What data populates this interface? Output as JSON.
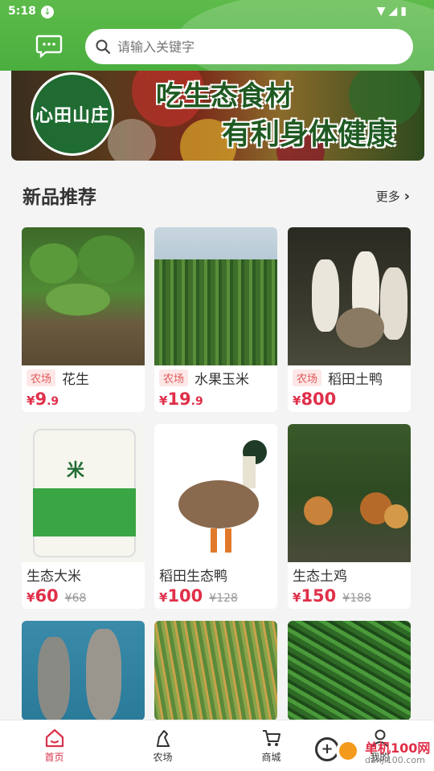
{
  "status_bar": {
    "time": "5:18",
    "icons": "▼◢▮"
  },
  "search": {
    "placeholder": "请输入关键字"
  },
  "banner": {
    "logo_text": "心田山庄",
    "line1": "吃生态食材",
    "line2": "有利身体健康"
  },
  "section": {
    "title": "新品推荐",
    "more": "更多"
  },
  "products": [
    {
      "tag": "农场",
      "name": "花生",
      "price_int": "9",
      "price_dec": ".9",
      "old_price": "",
      "currency": "¥"
    },
    {
      "tag": "农场",
      "name": "水果玉米",
      "price_int": "19",
      "price_dec": ".9",
      "old_price": "",
      "currency": "¥"
    },
    {
      "tag": "农场",
      "name": "稻田土鸭",
      "price_int": "800",
      "price_dec": "",
      "old_price": "",
      "currency": "¥"
    },
    {
      "tag": "",
      "name": "生态大米",
      "price_int": "60",
      "price_dec": "",
      "old_price": "¥68",
      "currency": "¥"
    },
    {
      "tag": "",
      "name": "稻田生态鸭",
      "price_int": "100",
      "price_dec": "",
      "old_price": "¥128",
      "currency": "¥"
    },
    {
      "tag": "",
      "name": "生态土鸡",
      "price_int": "150",
      "price_dec": "",
      "old_price": "¥188",
      "currency": "¥"
    }
  ],
  "tabs": [
    {
      "label": "首页",
      "icon": "home-icon",
      "active": true
    },
    {
      "label": "农场",
      "icon": "farm-icon",
      "active": false
    },
    {
      "label": "商城",
      "icon": "cart-icon",
      "active": false
    },
    {
      "label": "我的",
      "icon": "profile-icon",
      "active": false
    }
  ],
  "watermark": {
    "title": "单机100网",
    "url": "danji100.com"
  },
  "colors": {
    "brand_green": "#4aae3e",
    "price_red": "#e0304a",
    "tag_bg": "#fde7e7"
  }
}
